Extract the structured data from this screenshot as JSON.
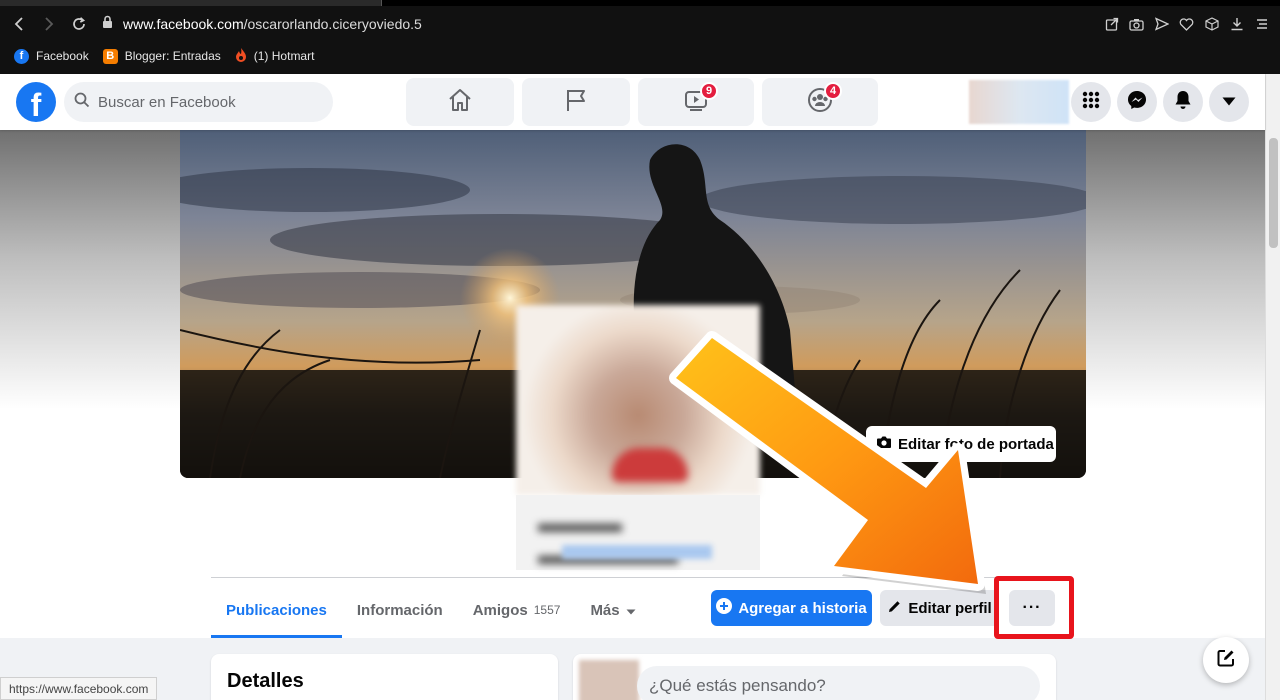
{
  "browser": {
    "url_domain": "www.facebook.com",
    "url_path": "/oscarorlando.ciceryoviedo.5",
    "bookmarks": [
      {
        "label": "Facebook",
        "icon": "facebook-icon",
        "color": "#1877f2"
      },
      {
        "label": "Blogger: Entradas",
        "icon": "blogger-icon",
        "color": "#f57d00"
      },
      {
        "label": "(1) Hotmart",
        "icon": "hotmart-flame-icon",
        "color": "#f04e23"
      }
    ],
    "status_url": "https://www.facebook.com"
  },
  "header": {
    "logo_letter": "f",
    "search_placeholder": "Buscar en Facebook",
    "nav": [
      {
        "name": "home-icon",
        "badge": ""
      },
      {
        "name": "pages-flag-icon",
        "badge": ""
      },
      {
        "name": "watch-video-icon",
        "badge": "9"
      },
      {
        "name": "groups-icon",
        "badge": "4"
      }
    ],
    "brand_color": "#1877f2",
    "badge_color": "#e41e3f"
  },
  "profile": {
    "cover_button_label": "Editar foto de portada",
    "tabs": [
      {
        "label": "Publicaciones",
        "active": true,
        "count": ""
      },
      {
        "label": "Información",
        "active": false,
        "count": ""
      },
      {
        "label": "Amigos",
        "active": false,
        "count": "1557"
      },
      {
        "label": "Más",
        "active": false,
        "count": ""
      }
    ],
    "add_story_label": "Agregar a historia",
    "edit_profile_label": "Editar perfil",
    "more_label": "···",
    "highlight_color": "#e8141c"
  },
  "feed": {
    "details_title": "Detalles",
    "post_placeholder": "¿Qué estás pensando?"
  }
}
